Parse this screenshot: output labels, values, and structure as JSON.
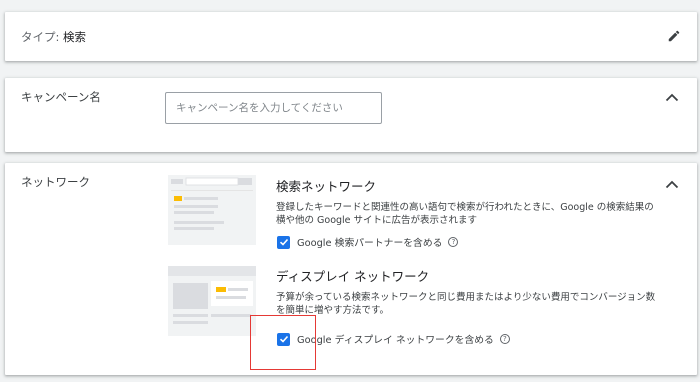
{
  "type_card": {
    "label": "タイプ:",
    "value": "検索"
  },
  "name_card": {
    "label": "キャンペーン名",
    "placeholder": "キャンペーン名を入力してください"
  },
  "network_card": {
    "label": "ネットワーク",
    "search": {
      "title": "検索ネットワーク",
      "description": "登録したキーワードと関連性の高い語句で検索が行われたときに、Google の検索結果の横や他の Google サイトに広告が表示されます",
      "checkbox_label": "Google 検索パートナーを含める",
      "checked": true
    },
    "display": {
      "title": "ディスプレイ ネットワーク",
      "description": "予算が余っている検索ネットワークと同じ費用またはより少ない費用でコンバージョン数を簡単に増やす方法です。",
      "checkbox_label": "Google ディスプレイ ネットワークを含める",
      "checked": true
    }
  },
  "icons": {
    "edit": "pencil-icon",
    "collapse": "chevron-up-icon",
    "help": "help-circle-icon",
    "check": "check-icon"
  },
  "colors": {
    "accent": "#1a73e8",
    "highlight": "#e53935",
    "illustration_accent": "#fbbc04"
  }
}
